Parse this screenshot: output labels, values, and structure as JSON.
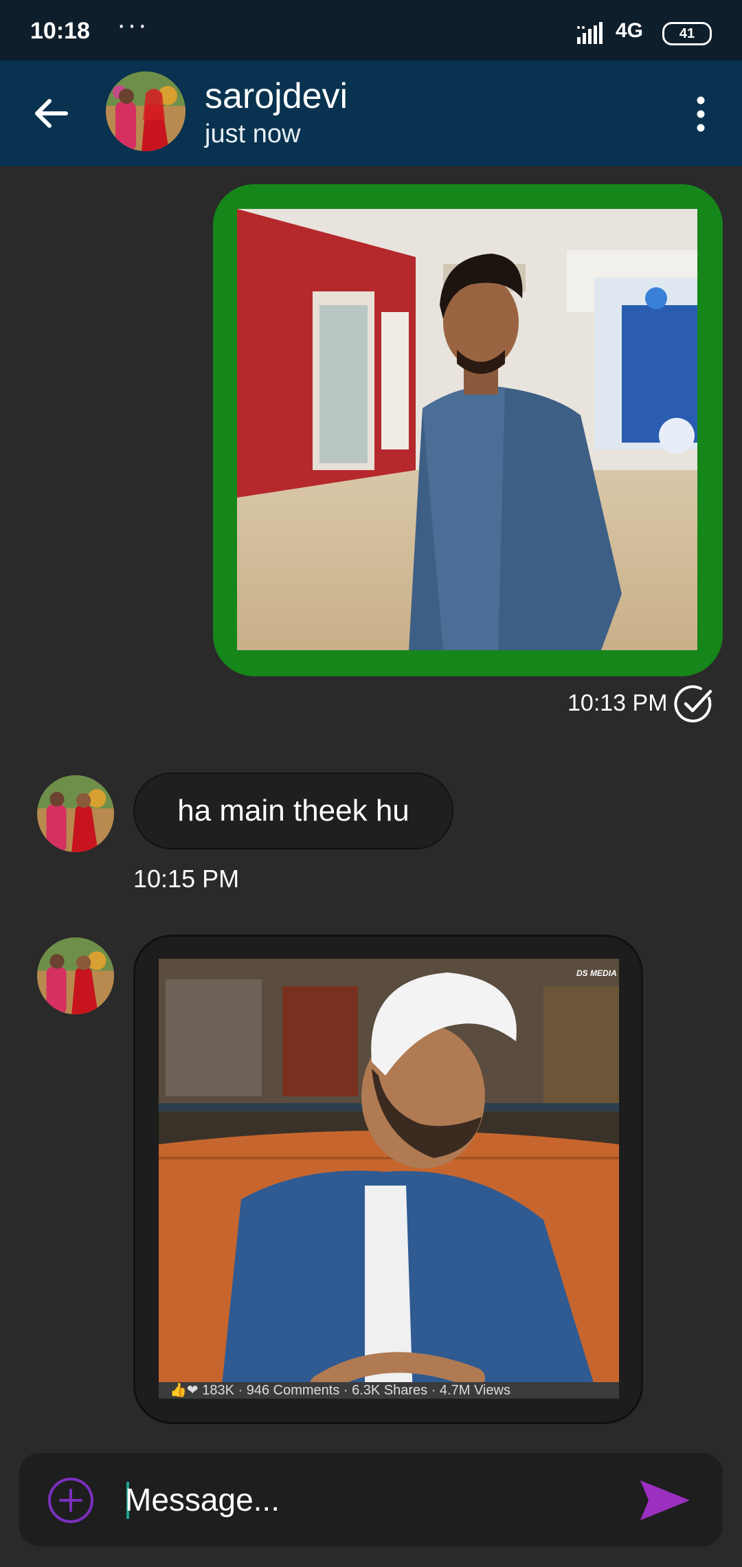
{
  "status_bar": {
    "time": "10:18",
    "dots": "···",
    "network": "4G",
    "battery": "41"
  },
  "header": {
    "contact_name": "sarojdevi",
    "contact_status": "just now"
  },
  "messages": [
    {
      "type": "image",
      "direction": "sent",
      "time": "10:13 PM",
      "read": true
    },
    {
      "type": "text",
      "direction": "received",
      "text": "ha main theek hu",
      "time": "10:15 PM"
    },
    {
      "type": "image",
      "direction": "received",
      "watermark": "DS MEDIA",
      "stats": "👍❤ 183K · 946 Comments · 6.3K Shares · 4.7M Views"
    }
  ],
  "composer": {
    "placeholder": "Message..."
  },
  "colors": {
    "status_bar": "#0f1e2b",
    "app_bar": "#08324f",
    "background": "#2a2a2a",
    "sent_bubble": "#16861a",
    "accent": "#7b2fbe"
  }
}
